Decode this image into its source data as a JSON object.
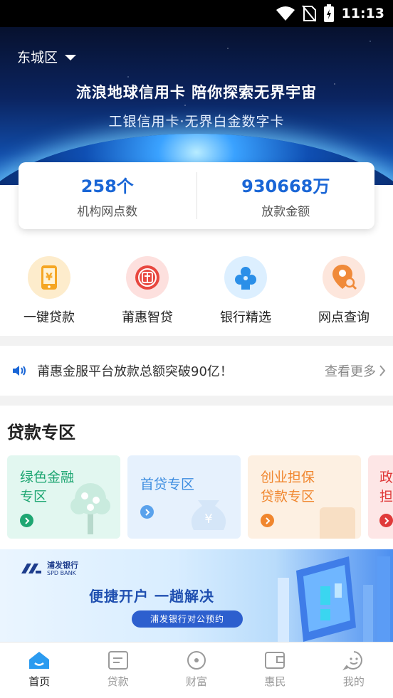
{
  "status_bar": {
    "time": "11:13",
    "icons": [
      "wifi-icon",
      "no-sim-icon",
      "battery-charging-icon"
    ]
  },
  "hero": {
    "district": "东城区",
    "title": "流浪地球信用卡  陪你探索无界宇宙",
    "subtitle": "工银信用卡·无界白金数字卡"
  },
  "stats": [
    {
      "value": "258个",
      "label": "机构网点数"
    },
    {
      "value": "930668万",
      "label": "放款金额"
    }
  ],
  "quick_actions": [
    {
      "label": "一键贷款",
      "icon": "phone-yen-icon",
      "bg": "#fdeccc",
      "color": "#f5a623"
    },
    {
      "label": "莆惠智贷",
      "icon": "loan-badge-icon",
      "bg": "#fde0de",
      "color": "#e8473f"
    },
    {
      "label": "银行精选",
      "icon": "bank-select-icon",
      "bg": "#dcefff",
      "color": "#2b8fe8"
    },
    {
      "label": "网点查询",
      "icon": "location-search-icon",
      "bg": "#fde6dc",
      "color": "#f08a3a"
    }
  ],
  "notice": {
    "text": "莆惠金服平台放款总额突破90亿！",
    "more": "查看更多"
  },
  "loan_section": {
    "title": "贷款专区",
    "cards": [
      {
        "title_line1": "绿色金融",
        "title_line2": "专区",
        "bg": "#e2f7f0",
        "color": "#1ea672"
      },
      {
        "title_line1": "首贷专区",
        "title_line2": "",
        "bg": "#e6f1fd",
        "color": "#3d8de0"
      },
      {
        "title_line1": "创业担保",
        "title_line2": "贷款专区",
        "bg": "#fdf0e2",
        "color": "#f0862e"
      },
      {
        "title_line1": "政",
        "title_line2": "担",
        "bg": "#fde6e6",
        "color": "#e03a3a"
      }
    ]
  },
  "banner": {
    "bank_name": "浦发银行",
    "bank_name_en": "SPD BANK",
    "slogan": "便捷开户  一趟解决",
    "pill": "浦发银行对公预约"
  },
  "bottom_nav": [
    {
      "label": "首页",
      "icon": "home-icon",
      "active": true
    },
    {
      "label": "贷款",
      "icon": "loan-doc-icon",
      "active": false
    },
    {
      "label": "财富",
      "icon": "wealth-icon",
      "active": false
    },
    {
      "label": "惠民",
      "icon": "benefit-card-icon",
      "active": false
    },
    {
      "label": "我的",
      "icon": "profile-icon",
      "active": false
    }
  ]
}
